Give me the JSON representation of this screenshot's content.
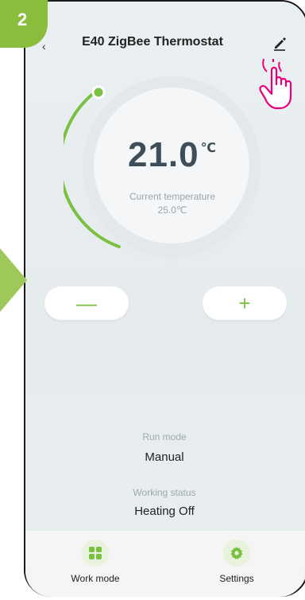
{
  "header": {
    "step_number": "2",
    "title": "E40 ZigBee Thermostat"
  },
  "dial": {
    "setpoint": "21.0",
    "unit": "℃",
    "current_label": "Current temperature",
    "current_value": "25.0℃"
  },
  "controls": {
    "decrease_label": "—",
    "increase_label": "+"
  },
  "status": {
    "run_mode_label": "Run mode",
    "run_mode_value": "Manual",
    "working_status_label": "Working status",
    "working_status_value": "Heating Off"
  },
  "bottom_nav": {
    "work_mode_label": "Work mode",
    "settings_label": "Settings"
  },
  "colors": {
    "accent_green": "#7bc043",
    "badge_green": "#8bbd3d",
    "hand_pink": "#e6007e"
  },
  "icons": {
    "edit": "pencil-icon",
    "work_mode": "grid-icon",
    "settings": "gear-icon",
    "pointer": "hand-pointer-icon"
  }
}
